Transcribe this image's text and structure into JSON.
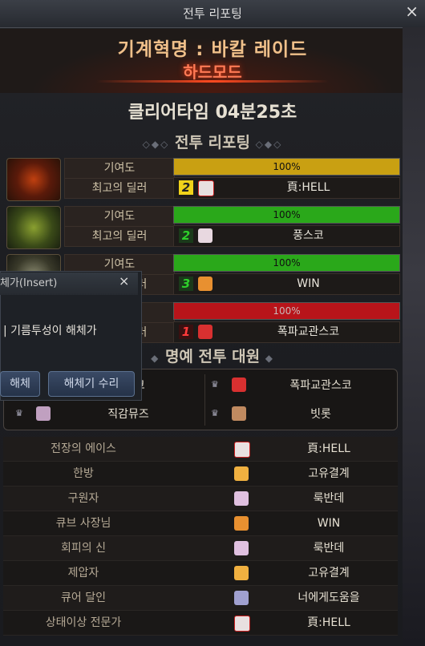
{
  "window": {
    "title": "전투 리포팅",
    "close_icon": "×"
  },
  "banner": {
    "dungeon": "기계혁명 : 바칼 레이드",
    "mode": "하드모드"
  },
  "clear_time": "클리어타임  04분25초",
  "section_report": "전투 리포팅",
  "party": [
    {
      "contribution_label": "기여도",
      "contribution_value": "100%",
      "bar_color": "#c9a012",
      "dealer_label": "최고의 딜러",
      "rank": "2",
      "rank_color": "#f0d21a",
      "name": "頁:HELL"
    },
    {
      "contribution_label": "기여도",
      "contribution_value": "100%",
      "bar_color": "#2aa81a",
      "dealer_label": "최고의 딜러",
      "rank": "2",
      "rank_color": "#2ed02a",
      "name": "풍스코"
    },
    {
      "contribution_label": "기여도",
      "contribution_value": "100%",
      "bar_color": "#2aa81a",
      "dealer_label": "최고의 딜러",
      "rank": "3",
      "rank_color": "#2ed02a",
      "name": "WIN"
    },
    {
      "contribution_label": "기여도",
      "contribution_value": "100%",
      "bar_color": "#b8141a",
      "dealer_label": "최고의 딜러",
      "rank": "1",
      "rank_color": "#d82a2a",
      "name": "폭파교관스코"
    }
  ],
  "section_honor": "명예 전투 대원",
  "honor": [
    {
      "name": "스코"
    },
    {
      "name": "폭파교관스코"
    },
    {
      "name": "직감뮤즈"
    },
    {
      "name": "빗롯"
    }
  ],
  "awards": [
    {
      "title": "전장의 에이스",
      "name": "頁:HELL"
    },
    {
      "title": "한방",
      "name": "고유결계"
    },
    {
      "title": "구원자",
      "name": "룩반데"
    },
    {
      "title": "큐브 사장님",
      "name": "WIN"
    },
    {
      "title": "회피의 신",
      "name": "룩반데"
    },
    {
      "title": "제압자",
      "name": "고유결계"
    },
    {
      "title": "큐어 달인",
      "name": "너에게도움을"
    },
    {
      "title": "상태이상 전문가",
      "name": "頁:HELL"
    }
  ],
  "dialog": {
    "title": "체가(Insert)",
    "close": "×",
    "message": "| 기름투성이 해체가",
    "btn_disassemble": "해체",
    "btn_repair": "해체기 수리"
  }
}
